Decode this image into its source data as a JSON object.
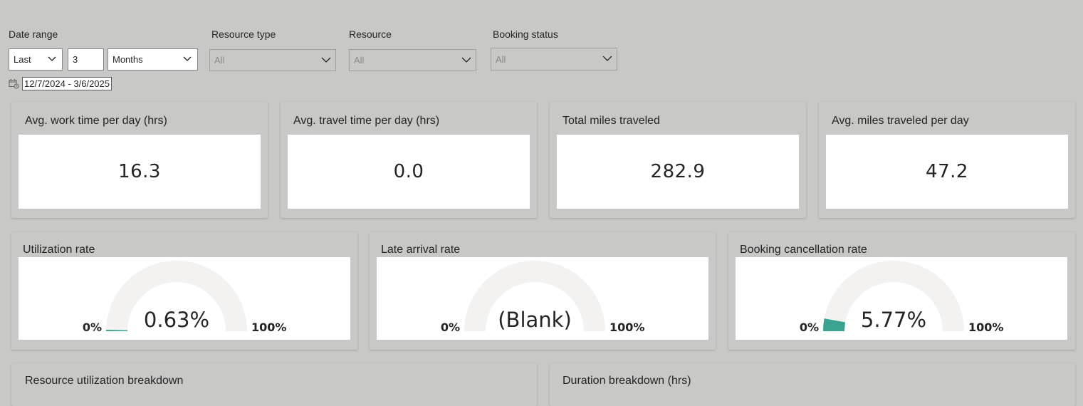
{
  "filters": {
    "date_range": {
      "label": "Date range",
      "period": "Last",
      "count": "3",
      "unit": "Months",
      "range_text": "12/7/2024 - 3/6/2025"
    },
    "resource_type": {
      "label": "Resource type",
      "value": "All"
    },
    "resource": {
      "label": "Resource",
      "value": "All"
    },
    "booking_status": {
      "label": "Booking status",
      "value": "All"
    }
  },
  "kpis": [
    {
      "title": "Avg. work time per day (hrs)",
      "value": "16.3"
    },
    {
      "title": "Avg. travel time per day (hrs)",
      "value": "0.0"
    },
    {
      "title": "Total miles traveled",
      "value": "282.9"
    },
    {
      "title": "Avg. miles traveled per day",
      "value": "47.2"
    }
  ],
  "gauges": [
    {
      "title": "Utilization rate",
      "value_text": "0.63%",
      "value": 0.63,
      "min_label": "0%",
      "max_label": "100%"
    },
    {
      "title": "Late arrival rate",
      "value_text": "(Blank)",
      "value": 0,
      "min_label": "0%",
      "max_label": "100%"
    },
    {
      "title": "Booking cancellation rate",
      "value_text": "5.77%",
      "value": 5.77,
      "min_label": "0%",
      "max_label": "100%"
    }
  ],
  "bottom_cards": [
    {
      "title": "Resource utilization breakdown"
    },
    {
      "title": "Duration breakdown (hrs)"
    }
  ],
  "colors": {
    "background": "#c8c8c7",
    "gauge_track": "#f3f2f1",
    "gauge_fill": "#3aa28f"
  }
}
